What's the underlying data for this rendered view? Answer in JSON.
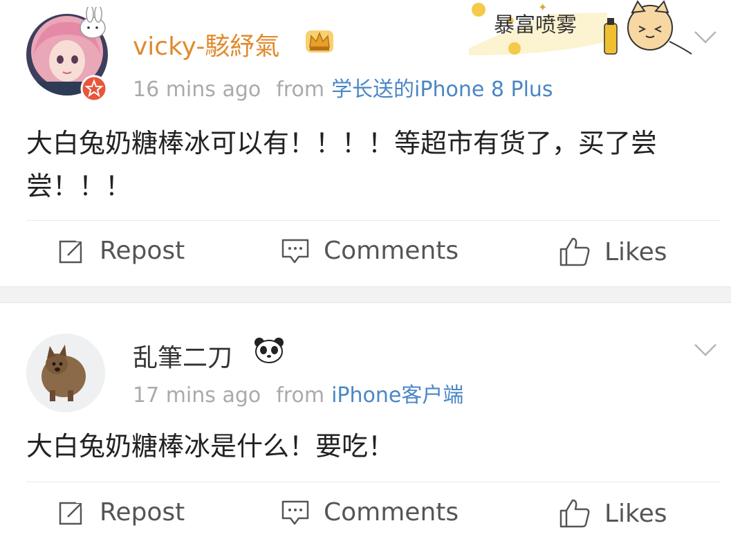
{
  "posts": [
    {
      "username": "vicky-駭紓氣",
      "username_color": "#e08a2c",
      "time": "16 mins ago",
      "from_label": "from",
      "source": "学长送的iPhone 8 Plus",
      "text": "大白兔奶糖棒冰可以有！！！！等超市有货了，买了尝尝！！！",
      "badges": [
        "crown-icon",
        "star-badge-icon"
      ],
      "decoration_text": "暴富喷雾",
      "actions": {
        "repost": "Repost",
        "comments": "Comments",
        "likes": "Likes"
      }
    },
    {
      "username": "乱筆二刀",
      "username_color": "#333333",
      "time": "17 mins ago",
      "from_label": "from",
      "source": "iPhone客户端",
      "text": "大白兔奶糖棒冰是什么！要吃！",
      "badges": [
        "panda-icon"
      ],
      "actions": {
        "repost": "Repost",
        "comments": "Comments",
        "likes": "Likes"
      }
    }
  ],
  "colors": {
    "link": "#4a86c5",
    "meta": "#aaaaaa",
    "action": "#555555",
    "separator": "#f2f2f2"
  }
}
